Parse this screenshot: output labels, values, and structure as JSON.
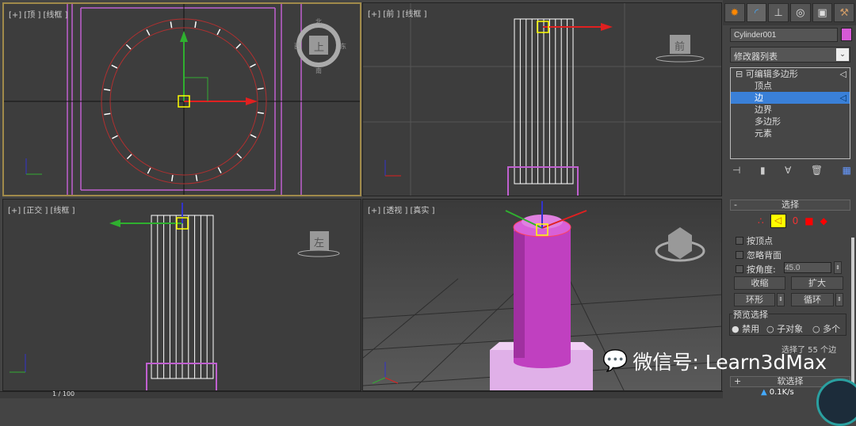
{
  "viewports": {
    "top": {
      "label": "[+] [顶 ] [线框 ]",
      "cube": {
        "face": "上",
        "n": "北",
        "s": "南",
        "w": "西",
        "e": "东"
      }
    },
    "front": {
      "label": "[+] [前 ] [线框 ]",
      "cube": {
        "face": "前"
      }
    },
    "ortho": {
      "label": "[+] [正交 ] [线框 ]",
      "cube": {
        "face": "左"
      }
    },
    "persp": {
      "label": "[+] [透视 ] [真实 ]"
    }
  },
  "panel": {
    "tabs": [
      "create-icon",
      "modify-icon",
      "hierarchy-icon",
      "motion-icon",
      "display-icon",
      "utilities-icon"
    ],
    "object_name": "Cylinder001",
    "object_color": "#d65ad6",
    "modifier_list": "修改器列表",
    "stack": {
      "root": "可编辑多边形",
      "items": [
        "顶点",
        "边",
        "边界",
        "多边形",
        "元素"
      ],
      "selected": "边"
    },
    "selection": {
      "title": "选择",
      "by_vertex": "按顶点",
      "ignore_backfacing": "忽略背面",
      "by_angle": "按角度:",
      "angle": "45.0",
      "shrink": "收缩",
      "grow": "扩大",
      "ring": "环形",
      "loop": "循环",
      "preview_title": "预览选择",
      "preview_options": [
        "禁用",
        "子对象",
        "多个"
      ],
      "preview_selected": "禁用",
      "status": "选择了 55 个边"
    },
    "soft_selection": "软选择"
  },
  "watermark": "微信号: Learn3dMax",
  "statusbar": {
    "frame": "1 / 100",
    "net": "0.1K/s"
  }
}
